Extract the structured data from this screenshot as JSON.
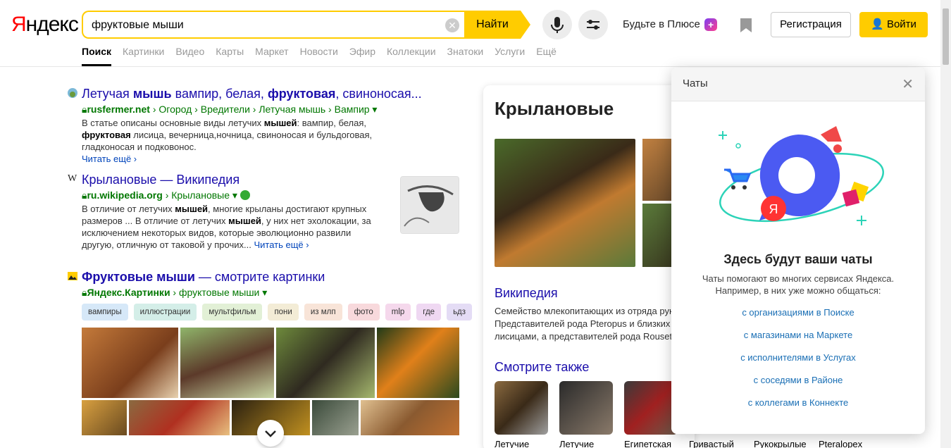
{
  "logo": {
    "first": "Я",
    "rest": "ндекс"
  },
  "search": {
    "query": "фруктовые мыши",
    "button": "Найти"
  },
  "header": {
    "plus_text": "Будьте в Плюсе",
    "plus_badge": "+",
    "register": "Регистрация",
    "login": "Войти"
  },
  "tabs": [
    "Поиск",
    "Картинки",
    "Видео",
    "Карты",
    "Маркет",
    "Новости",
    "Эфир",
    "Коллекции",
    "Знатоки",
    "Услуги",
    "Ещё"
  ],
  "results": [
    {
      "title_parts": [
        "Летучая ",
        "мышь",
        " вампир, белая, ",
        "фруктовая",
        ", свиноносая..."
      ],
      "url_domain": "rusfermer.net",
      "url_path": " › Огород › Вредители › Летучая мышь › Вампир ▾",
      "snippet_parts": [
        "В статье описаны основные виды летучих ",
        "мышей",
        ": вампир, белая, ",
        "фруктовая",
        " лисица, вечерница,ночница, свиноносая и бульдоговая, гладконосая и подковонос."
      ],
      "more": "Читать ещё ›"
    },
    {
      "fav": "W",
      "title": "Крылановые — Википедия",
      "url_domain": "ru.wikipedia.org",
      "url_path": " › Крылановые ▾",
      "snippet_parts": [
        "В отличие от летучих ",
        "мышей",
        ", многие крыланы достигают крупных размеров ... В отличие от летучих ",
        "мышей",
        ", у них нет эхолокации, за исключением некоторых видов, которые эволюционно развили другую, отличную от таковой у прочих..."
      ],
      "more": "Читать ещё ›"
    },
    {
      "title_bold": "Фруктовые мыши",
      "title_rest": " — смотрите картинки",
      "url_domain": "Яндекс.Картинки",
      "url_path": " › фруктовые мыши ▾"
    }
  ],
  "chips": [
    {
      "label": "вампиры",
      "color": "#d6e8f8"
    },
    {
      "label": "иллюстрации",
      "color": "#d4eee8"
    },
    {
      "label": "мультфильм",
      "color": "#e2f0d6"
    },
    {
      "label": "пони",
      "color": "#f3ecd6"
    },
    {
      "label": "из млп",
      "color": "#f8e4d8"
    },
    {
      "label": "фото",
      "color": "#f8d9dc"
    },
    {
      "label": "mlp",
      "color": "#f5d8ec"
    },
    {
      "label": "где",
      "color": "#efd8f2"
    },
    {
      "label": "ьдз",
      "color": "#e4dcf5"
    }
  ],
  "knowledge": {
    "title": "Крылановые",
    "wiki": "Википедия",
    "desc_lines": [
      "Семейство млекопитающих из отряда рук",
      "Представителей рода Pteropus и близких",
      "лисицами, а представителей рода Rousett"
    ],
    "see_also": "Смотрите также",
    "see_items": [
      "Летучие",
      "Летучие",
      "Египетская",
      "Гривастый",
      "Рукокрылые",
      "Pteralopex"
    ]
  },
  "chats": {
    "header": "Чаты",
    "heading": "Здесь будут ваши чаты",
    "para1": "Чаты помогают во многих сервисах Яндекса.",
    "para2": "Например, в них уже можно общаться:",
    "links": [
      "с организациями в Поиске",
      "с магазинами на Маркете",
      "с исполнителями в Услугах",
      "с соседями в Районе",
      "с коллегами в Коннекте"
    ],
    "ya_letter": "Я"
  }
}
